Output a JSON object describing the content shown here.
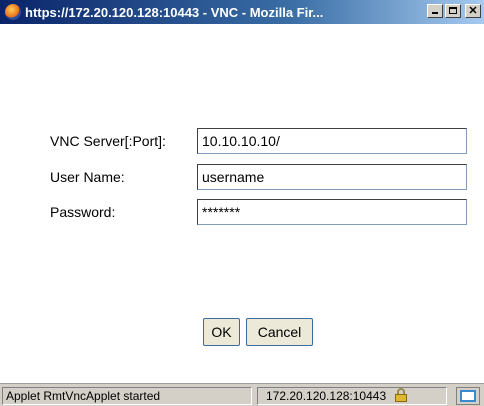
{
  "window": {
    "title": "https://172.20.120.128:10443 - VNC - Mozilla Fir..."
  },
  "form": {
    "server_label": "VNC Server[:Port]:",
    "server_value": "10.10.10.10/",
    "user_label": "User Name:",
    "user_value": "username",
    "password_label": "Password:",
    "password_value": "*******"
  },
  "buttons": {
    "ok": "OK",
    "cancel": "Cancel"
  },
  "statusbar": {
    "message": "Applet RmtVncApplet started",
    "host": "172.20.120.128:10443"
  },
  "icons": {
    "app": "firefox-icon",
    "lock": "lock-icon",
    "minimize": "minimize-icon",
    "maximize": "maximize-icon",
    "close": "close-icon"
  }
}
